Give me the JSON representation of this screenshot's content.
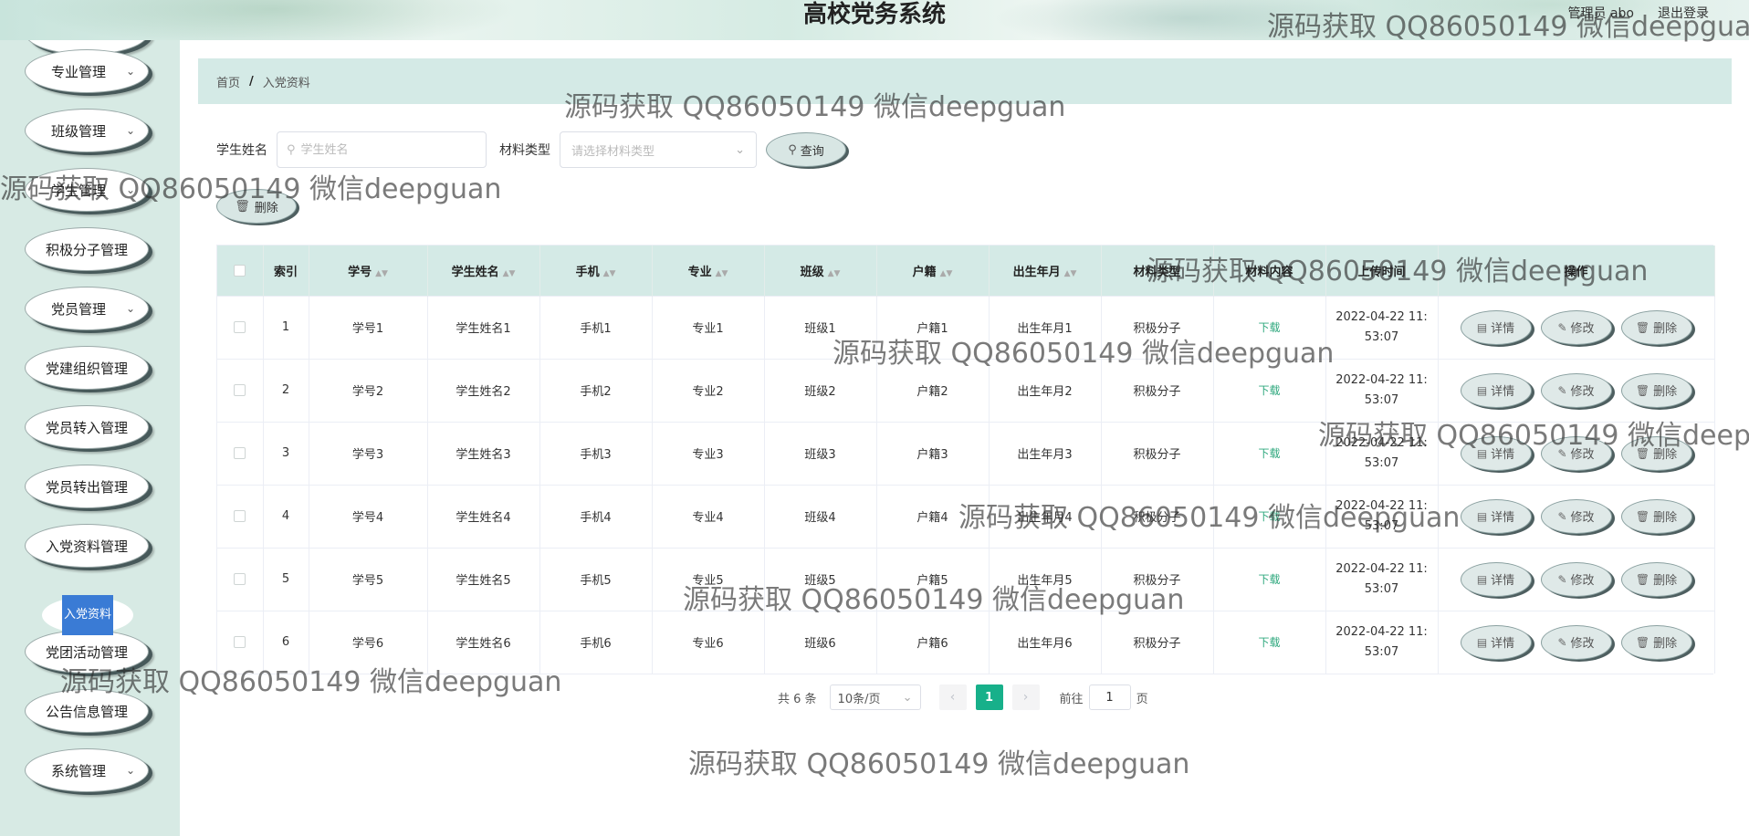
{
  "header": {
    "title": "高校党务系统",
    "user": "管理员 abo",
    "logout": "退出登录"
  },
  "sidebar": {
    "items": [
      {
        "label": "专业管理",
        "arrow": true
      },
      {
        "label": "班级管理",
        "arrow": true
      },
      {
        "label": "学生管理",
        "arrow": true
      },
      {
        "label": "积极分子管理",
        "arrow": false
      },
      {
        "label": "党员管理",
        "arrow": true
      },
      {
        "label": "党建组织管理",
        "arrow": false
      },
      {
        "label": "党员转入管理",
        "arrow": false
      },
      {
        "label": "党员转出管理",
        "arrow": false
      },
      {
        "label": "入党资料管理",
        "arrow": false
      },
      {
        "label": "党团活动管理",
        "arrow": false
      },
      {
        "label": "公告信息管理",
        "arrow": false
      },
      {
        "label": "系统管理",
        "arrow": true
      }
    ],
    "active_sub": "入党资料"
  },
  "breadcrumb": {
    "home": "首页",
    "sep": "/",
    "current": "入党资料"
  },
  "search": {
    "name_label": "学生姓名",
    "name_placeholder": "学生姓名",
    "type_label": "材料类型",
    "type_placeholder": "请选择材料类型",
    "query_label": "查询"
  },
  "toolbar": {
    "delete_label": "删除"
  },
  "table": {
    "headers": [
      "索引",
      "学号",
      "学生姓名",
      "手机",
      "专业",
      "班级",
      "户籍",
      "出生年月",
      "材料类型",
      "材料内容",
      "上传时间",
      "操作"
    ],
    "rows": [
      {
        "idx": "1",
        "no": "学号1",
        "name": "学生姓名1",
        "phone": "手机1",
        "major": "专业1",
        "cls": "班级1",
        "hukou": "户籍1",
        "birth": "出生年月1",
        "type": "积极分子",
        "content": "下载",
        "time1": "2022-04-22 11:",
        "time2": "53:07"
      },
      {
        "idx": "2",
        "no": "学号2",
        "name": "学生姓名2",
        "phone": "手机2",
        "major": "专业2",
        "cls": "班级2",
        "hukou": "户籍2",
        "birth": "出生年月2",
        "type": "积极分子",
        "content": "下载",
        "time1": "2022-04-22 11:",
        "time2": "53:07"
      },
      {
        "idx": "3",
        "no": "学号3",
        "name": "学生姓名3",
        "phone": "手机3",
        "major": "专业3",
        "cls": "班级3",
        "hukou": "户籍3",
        "birth": "出生年月3",
        "type": "积极分子",
        "content": "下载",
        "time1": "2022-04-22 11:",
        "time2": "53:07"
      },
      {
        "idx": "4",
        "no": "学号4",
        "name": "学生姓名4",
        "phone": "手机4",
        "major": "专业4",
        "cls": "班级4",
        "hukou": "户籍4",
        "birth": "出生年月4",
        "type": "积极分子",
        "content": "下载",
        "time1": "2022-04-22 11:",
        "time2": "53:07"
      },
      {
        "idx": "5",
        "no": "学号5",
        "name": "学生姓名5",
        "phone": "手机5",
        "major": "专业5",
        "cls": "班级5",
        "hukou": "户籍5",
        "birth": "出生年月5",
        "type": "积极分子",
        "content": "下载",
        "time1": "2022-04-22 11:",
        "time2": "53:07"
      },
      {
        "idx": "6",
        "no": "学号6",
        "name": "学生姓名6",
        "phone": "手机6",
        "major": "专业6",
        "cls": "班级6",
        "hukou": "户籍6",
        "birth": "出生年月6",
        "type": "积极分子",
        "content": "下载",
        "time1": "2022-04-22 11:",
        "time2": "53:07"
      }
    ],
    "actions": {
      "detail": "详情",
      "edit": "修改",
      "delete": "删除"
    }
  },
  "pagination": {
    "total": "共 6 条",
    "page_size": "10条/页",
    "current_page": "1",
    "goto_prefix": "前往",
    "goto_value": "1",
    "goto_suffix": "页"
  },
  "watermark": "源码获取 QQ86050149 微信deepguan",
  "colors": {
    "sidebar_bg": "#d7eae4",
    "header_bar": "#d4eae6",
    "accent_green": "#17b08a",
    "download_link": "#2fa87e"
  }
}
